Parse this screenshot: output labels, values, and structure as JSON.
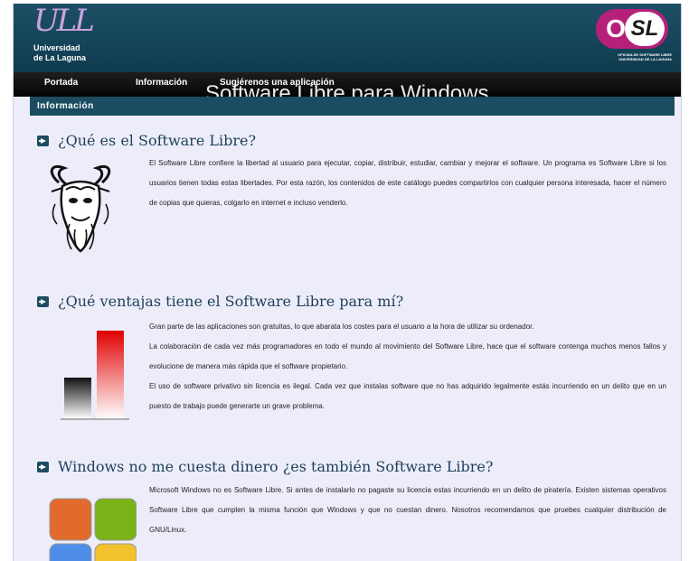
{
  "header": {
    "university_mark": "ULL",
    "university_name_line1": "Universidad",
    "university_name_line2": "de La Laguna",
    "osl_letters_o": "O",
    "osl_letters_sl": "SL",
    "osl_caption_line1": "OFICINA DE SOFTWARE LIBRE",
    "osl_caption_line2": "UNIVERSIDAD DE LA LAGUNA"
  },
  "nav": {
    "items": [
      {
        "label": "Portada"
      },
      {
        "label": "Información"
      },
      {
        "label": "Sugiérenos una aplicación"
      }
    ],
    "overlay_title": "Software Libre para Windows"
  },
  "section_bar": {
    "label": "Información"
  },
  "sections": [
    {
      "title": "¿Qué es el Software Libre?",
      "paragraphs": [
        "El Software Libre confiere la libertad al usuario para ejecutar, copiar, distribuir, estudiar, cambiar y mejorar el software. Un programa es Software Libre si los usuarios tienen todas estas libertades. Por esta razón, los contenidos de este catálogo puedes compartirlos con cualquier persona interesada, hacer el número de copias que quieras, colgarlo en internet e incluso venderlo."
      ]
    },
    {
      "title": "¿Qué ventajas tiene el Software Libre para mí?",
      "paragraphs": [
        "Gran parte de las aplicaciones son gratuitas, lo que abarata los costes para el usuario a la hora de utilizar su ordenador.",
        "La colaboración de cada vez más programadores en todo el mundo al movimiento del Software Libre, hace que el software contenga muchos menos fallos y evolucione de manera más rápida que el software propietario.",
        "El uso de software privativo sin licencia es ilegal. Cada vez que instalas software que no has adquirido legalmente estás incurriendo en un delito que en un puesto de trabajo puede generarte un grave problema."
      ]
    },
    {
      "title": "Windows no me cuesta dinero ¿es también Software Libre?",
      "paragraphs": [
        "Microsoft Windows no es Software Libre. Si antes de instalarlo no pagaste su licencia estas incurriendo en un delito de piratería. Existen sistemas operativos Software Libre que cumplen la misma función que Windows y que no cuestan dinero. Nosotros recomendamos que pruebes cualquier distribución de GNU/Linux."
      ]
    }
  ],
  "colors": {
    "header_bg": "#17485e",
    "nav_bg": "#0a0a0a",
    "accent": "#1b4c61",
    "content_bg": "#ededfa",
    "osl_magenta": "#b5207a",
    "bar_red": "#e00000",
    "bar_black": "#111111"
  },
  "icons": [
    "ull-logo",
    "osl-logo",
    "arrow-right-icon",
    "gnu-head-icon",
    "comparison-bars-icon",
    "windows-logo-icon"
  ]
}
